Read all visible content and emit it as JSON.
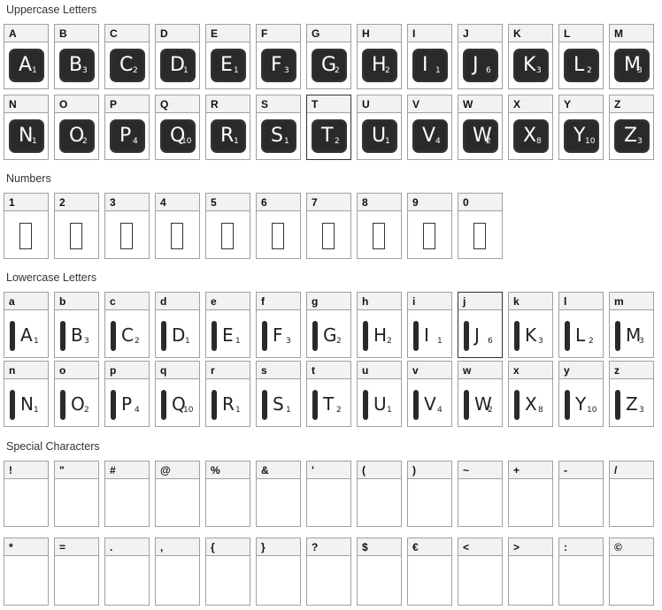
{
  "sections": {
    "uppercase": "Uppercase Letters",
    "numbers": "Numbers",
    "lowercase": "Lowercase Letters",
    "special": "Special Characters"
  },
  "uppercase": [
    {
      "key": "A",
      "glyph": "A",
      "num": "1"
    },
    {
      "key": "B",
      "glyph": "B",
      "num": "3"
    },
    {
      "key": "C",
      "glyph": "C",
      "num": "2"
    },
    {
      "key": "D",
      "glyph": "D",
      "num": "1"
    },
    {
      "key": "E",
      "glyph": "E",
      "num": "1"
    },
    {
      "key": "F",
      "glyph": "F",
      "num": "3"
    },
    {
      "key": "G",
      "glyph": "G",
      "num": "2"
    },
    {
      "key": "H",
      "glyph": "H",
      "num": "2"
    },
    {
      "key": "I",
      "glyph": "I",
      "num": "1"
    },
    {
      "key": "J",
      "glyph": "J",
      "num": "6"
    },
    {
      "key": "K",
      "glyph": "K",
      "num": "3"
    },
    {
      "key": "L",
      "glyph": "L",
      "num": "2"
    },
    {
      "key": "M",
      "glyph": "M",
      "num": "3"
    },
    {
      "key": "N",
      "glyph": "N",
      "num": "1"
    },
    {
      "key": "O",
      "glyph": "O",
      "num": "2"
    },
    {
      "key": "P",
      "glyph": "P",
      "num": "4"
    },
    {
      "key": "Q",
      "glyph": "Q",
      "num": "10"
    },
    {
      "key": "R",
      "glyph": "R",
      "num": "1"
    },
    {
      "key": "S",
      "glyph": "S",
      "num": "1"
    },
    {
      "key": "T",
      "glyph": "T",
      "num": "2"
    },
    {
      "key": "U",
      "glyph": "U",
      "num": "1"
    },
    {
      "key": "V",
      "glyph": "V",
      "num": "4"
    },
    {
      "key": "W",
      "glyph": "W",
      "num": "2"
    },
    {
      "key": "X",
      "glyph": "X",
      "num": "8"
    },
    {
      "key": "Y",
      "glyph": "Y",
      "num": "10"
    },
    {
      "key": "Z",
      "glyph": "Z",
      "num": "3"
    }
  ],
  "numbers": [
    "1",
    "2",
    "3",
    "4",
    "5",
    "6",
    "7",
    "8",
    "9",
    "0"
  ],
  "lowercase": [
    {
      "key": "a",
      "glyph": "A",
      "num": "1"
    },
    {
      "key": "b",
      "glyph": "B",
      "num": "3"
    },
    {
      "key": "c",
      "glyph": "C",
      "num": "2"
    },
    {
      "key": "d",
      "glyph": "D",
      "num": "1"
    },
    {
      "key": "e",
      "glyph": "E",
      "num": "1"
    },
    {
      "key": "f",
      "glyph": "F",
      "num": "3"
    },
    {
      "key": "g",
      "glyph": "G",
      "num": "2"
    },
    {
      "key": "h",
      "glyph": "H",
      "num": "2"
    },
    {
      "key": "i",
      "glyph": "I",
      "num": "1"
    },
    {
      "key": "j",
      "glyph": "J",
      "num": "6"
    },
    {
      "key": "k",
      "glyph": "K",
      "num": "3"
    },
    {
      "key": "l",
      "glyph": "L",
      "num": "2"
    },
    {
      "key": "m",
      "glyph": "M",
      "num": "3"
    },
    {
      "key": "n",
      "glyph": "N",
      "num": "1"
    },
    {
      "key": "o",
      "glyph": "O",
      "num": "2"
    },
    {
      "key": "p",
      "glyph": "P",
      "num": "4"
    },
    {
      "key": "q",
      "glyph": "Q",
      "num": "10"
    },
    {
      "key": "r",
      "glyph": "R",
      "num": "1"
    },
    {
      "key": "s",
      "glyph": "S",
      "num": "1"
    },
    {
      "key": "t",
      "glyph": "T",
      "num": "2"
    },
    {
      "key": "u",
      "glyph": "U",
      "num": "1"
    },
    {
      "key": "v",
      "glyph": "V",
      "num": "4"
    },
    {
      "key": "w",
      "glyph": "W",
      "num": "2"
    },
    {
      "key": "x",
      "glyph": "X",
      "num": "8"
    },
    {
      "key": "y",
      "glyph": "Y",
      "num": "10"
    },
    {
      "key": "z",
      "glyph": "Z",
      "num": "3"
    }
  ],
  "special_row1": [
    "!",
    "\"",
    "#",
    "@",
    "%",
    "&",
    "'",
    "(",
    ")",
    "~",
    "+",
    "-",
    "/"
  ],
  "special_row2": [
    "*",
    "=",
    ".",
    ",",
    "{",
    "}",
    "?",
    "$",
    "€",
    "<",
    ">",
    ":",
    "©"
  ],
  "highlighted": {
    "uppercase": "T",
    "lowercase": "j"
  }
}
